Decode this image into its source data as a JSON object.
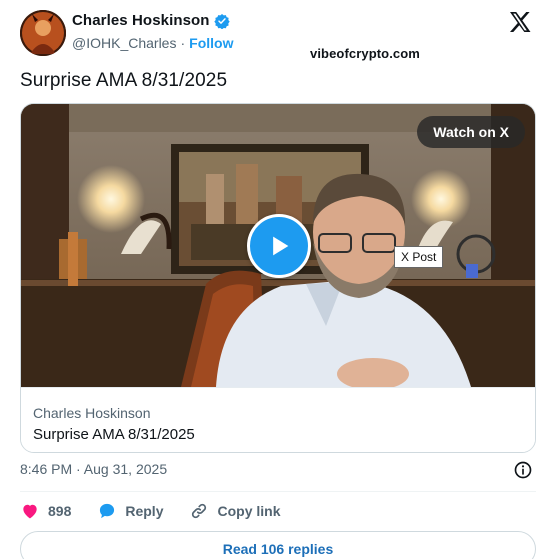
{
  "author": {
    "name": "Charles Hoskinson",
    "handle": "@IOHK_Charles",
    "separator": "·",
    "follow_label": "Follow",
    "verified": true
  },
  "watermark": "vibeofcrypto.com",
  "tweet": {
    "text": "Surprise AMA 8/31/2025"
  },
  "video_card": {
    "watch_label": "Watch on X",
    "tooltip": "X Post",
    "author": "Charles Hoskinson",
    "title": "Surprise AMA 8/31/2025"
  },
  "timestamp": "8:46 PM · Aug 31, 2025",
  "actions": {
    "likes": "898",
    "reply_label": "Reply",
    "copy_label": "Copy link"
  },
  "read_replies_label": "Read 106 replies",
  "colors": {
    "accent": "#1d9bf0",
    "like": "#f91880",
    "muted": "#536471"
  },
  "icons": [
    "verified-badge-icon",
    "x-logo-icon",
    "play-icon",
    "info-icon",
    "heart-icon",
    "reply-bubble-icon",
    "link-icon"
  ]
}
